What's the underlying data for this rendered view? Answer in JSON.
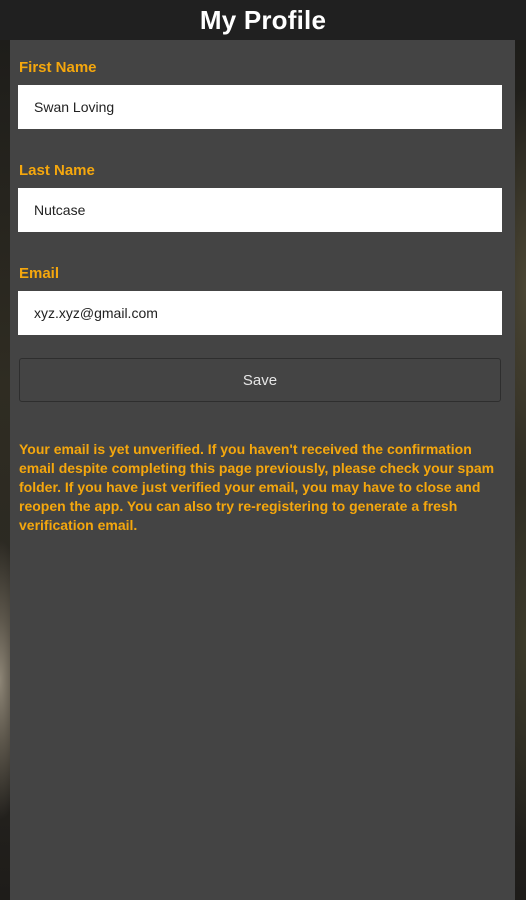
{
  "header": {
    "title": "My Profile"
  },
  "form": {
    "first_name": {
      "label": "First Name",
      "value": "Swan Loving"
    },
    "last_name": {
      "label": "Last Name",
      "value": "Nutcase"
    },
    "email": {
      "label": "Email",
      "value": "xyz.xyz@gmail.com"
    },
    "save_label": "Save"
  },
  "notice": {
    "text": "Your email is yet unverified. If you haven't received the confirmation email despite completing this page previously, please check your spam folder. If you have just verified your email, you may have to close and reopen the app. You can also try re-registering to generate a fresh verification email."
  },
  "colors": {
    "accent": "#f5a70d",
    "panel": "#444444",
    "header": "#202020"
  }
}
